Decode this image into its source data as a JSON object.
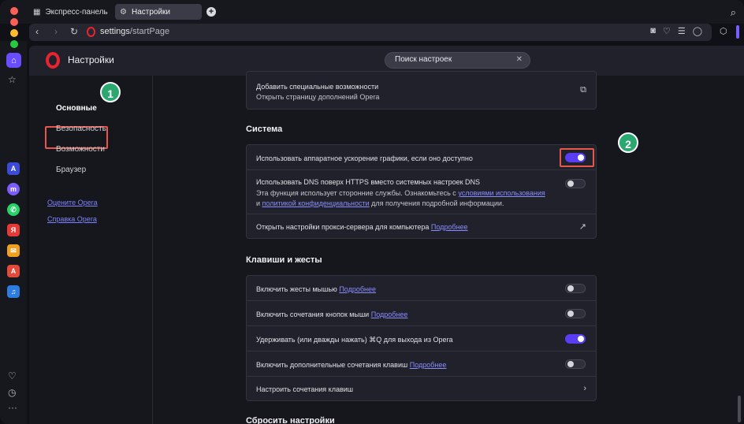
{
  "tabs": [
    {
      "label": "Экспресс-панель",
      "icon": "grid-icon"
    },
    {
      "label": "Настройки",
      "icon": "gear-icon"
    }
  ],
  "address": {
    "host": "settings",
    "path": "/startPage"
  },
  "header": {
    "title": "Настройки",
    "search_placeholder": "Поиск настроек"
  },
  "leftnav": {
    "items": [
      "Основные",
      "Безопасность",
      "Возможности",
      "Браузер"
    ],
    "links": [
      "Оцените Opera",
      "Справка Opera"
    ]
  },
  "annotations": {
    "badge1": "1",
    "badge2": "2"
  },
  "accessibility_card": {
    "line1": "Добавить специальные возможности",
    "line2": "Открыть страницу дополнений Opera"
  },
  "system": {
    "title": "Система",
    "hw_accel": "Использовать аппаратное ускорение графики, если оно доступно",
    "dns_title": "Использовать DNS поверх HTTPS вместо системных настроек DNS",
    "dns_sub1_pre": "Эта функция использует сторонние службы. Ознакомьтесь с",
    "dns_sub1_link": "условиями использования",
    "dns_sub2_pre": "и",
    "dns_sub2_link": "политикой конфиденциальности",
    "dns_sub2_post": "для получения подробной информации.",
    "proxy": "Открыть настройки прокси-сервера для компьютера",
    "proxy_link": "Подробнее",
    "toggles": {
      "hw_accel": true,
      "dns": false
    }
  },
  "keys": {
    "title": "Клавиши и жесты",
    "rows": [
      {
        "label": "Включить жесты мышью",
        "link": "Подробнее",
        "on": false
      },
      {
        "label": "Включить сочетания кнопок мыши",
        "link": "Подробнее",
        "on": false
      },
      {
        "label": "Удерживать (или дважды нажать) ⌘Q для выхода из Opera",
        "link": "",
        "on": true
      },
      {
        "label": "Включить дополнительные сочетания клавиш",
        "link": "Подробнее",
        "on": false
      }
    ],
    "configure": "Настроить сочетания клавиш"
  },
  "reset": {
    "title": "Сбросить настройки"
  },
  "colors": {
    "accent": "#5a3df5",
    "brand": "#e8242f",
    "highlight": "#e8574a",
    "badge": "#2aa870"
  }
}
